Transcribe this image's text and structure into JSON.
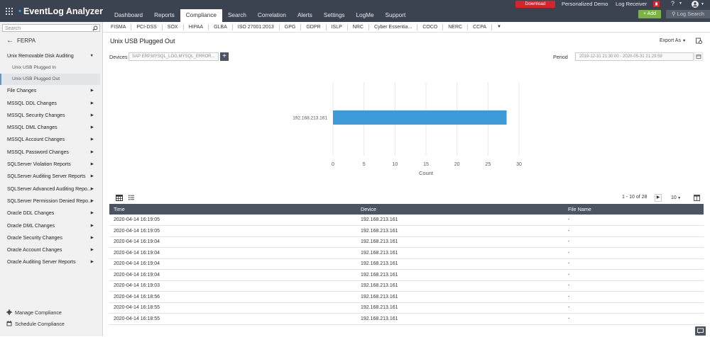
{
  "app": {
    "name": "EventLog Analyzer"
  },
  "top_nav": [
    "Dashboard",
    "Reports",
    "Compliance",
    "Search",
    "Correlation",
    "Alerts",
    "Settings",
    "LogMe",
    "Support"
  ],
  "top_right": {
    "download": "Download",
    "personalized_demo": "Personalized Demo",
    "log_receiver": "Log Receiver",
    "help": "?",
    "add": "+ Add",
    "log_search": "Log Search"
  },
  "sidebar": {
    "search_placeholder": "Search",
    "back_label": "FERPA",
    "items": [
      {
        "label": "Unix Removable Disk Auditing",
        "type": "group"
      },
      {
        "label": "Unix USB Plugged In",
        "type": "sub"
      },
      {
        "label": "Unix USB Plugged Out",
        "type": "sub-active"
      },
      {
        "label": "File Changes",
        "type": "group"
      },
      {
        "label": "MSSQL DDL Changes",
        "type": "group"
      },
      {
        "label": "MSSQL Security Changes",
        "type": "group"
      },
      {
        "label": "MSSQL DML Changes",
        "type": "group"
      },
      {
        "label": "MSSQL Account Changes",
        "type": "group"
      },
      {
        "label": "MSSQL Password Changes",
        "type": "group"
      },
      {
        "label": "SQLServer Violation Reports",
        "type": "group"
      },
      {
        "label": "SQLServer Auditing Server Reports",
        "type": "group"
      },
      {
        "label": "SQLServer Advanced Auditing Repo...",
        "type": "group"
      },
      {
        "label": "SQLServer Permission Denied Repo...",
        "type": "group"
      },
      {
        "label": "Oracle DDL Changes",
        "type": "group"
      },
      {
        "label": "Oracle DML Changes",
        "type": "group"
      },
      {
        "label": "Oracle Security Changes",
        "type": "group"
      },
      {
        "label": "Oracle Account Changes",
        "type": "group"
      },
      {
        "label": "Oracle Auditing Server Reports",
        "type": "group"
      }
    ],
    "footer": {
      "manage": "Manage Compliance",
      "schedule": "Schedule Compliance"
    }
  },
  "compliance_tabs": [
    "FISMA",
    "PCI-DSS",
    "SOX",
    "HIPAA",
    "GLBA",
    "ISO 27001:2013",
    "GPG",
    "GDPR",
    "ISLP",
    "NRC",
    "Cyber Essentia...",
    "COCO",
    "NERC",
    "CCPA"
  ],
  "report": {
    "title": "Unix USB Plugged Out",
    "export_label": "Export As",
    "devices_label": "Devices",
    "devices_value": "SAP ERP,MYSQL_LOG,MYSQL_ERROR...",
    "period_label": "Period",
    "period_value": "2019-12-31 21:30:00 - 2020-05-31 21:29:59"
  },
  "colors": {
    "topbar": "#3b4350",
    "bar": "#3d9ad8",
    "table_header": "#4a5463",
    "add_button": "#7ab342",
    "download": "#d8232a"
  },
  "chart_data": {
    "type": "bar",
    "orientation": "horizontal",
    "categories": [
      "192.168.213.161"
    ],
    "values": [
      28
    ],
    "xlabel": "Count",
    "xlim": [
      0,
      30
    ],
    "xticks": [
      0,
      5,
      10,
      15,
      20,
      25,
      30
    ],
    "grid": true
  },
  "table": {
    "pager": "1 - 10 of 28",
    "per_page": "10",
    "columns": [
      "Time",
      "Device",
      "File Name"
    ],
    "rows": [
      [
        "2020-04-14 16:19:05",
        "192.168.213.161",
        "-"
      ],
      [
        "2020-04-14 16:19:05",
        "192.168.213.161",
        "-"
      ],
      [
        "2020-04-14 16:19:04",
        "192.168.213.161",
        "-"
      ],
      [
        "2020-04-14 16:19:04",
        "192.168.213.161",
        "-"
      ],
      [
        "2020-04-14 16:19:04",
        "192.168.213.161",
        "-"
      ],
      [
        "2020-04-14 16:19:04",
        "192.168.213.161",
        "-"
      ],
      [
        "2020-04-14 16:19:03",
        "192.168.213.161",
        "-"
      ],
      [
        "2020-04-14 16:18:56",
        "192.168.213.161",
        "-"
      ],
      [
        "2020-04-14 16:18:55",
        "192.168.213.161",
        "-"
      ],
      [
        "2020-04-14 16:18:55",
        "192.168.213.161",
        "-"
      ]
    ]
  }
}
